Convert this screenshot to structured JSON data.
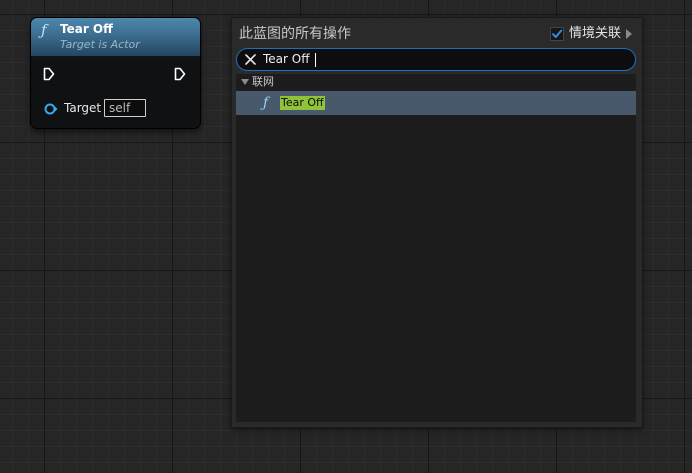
{
  "node": {
    "function_icon": "ƒ",
    "title": "Tear Off",
    "subtitle": "Target is Actor",
    "exec_in_icon": "exec-pin-in",
    "exec_out_icon": "exec-pin-out",
    "target_label": "Target",
    "target_value": "self",
    "header_color": "#3c6d8f"
  },
  "menu": {
    "title": "此蓝图的所有操作",
    "context_sensitive_label": "情境关联",
    "context_sensitive_checked": true,
    "search": {
      "value": "Tear Off",
      "placeholder": ""
    },
    "categories": [
      {
        "label": "联网",
        "expanded": true,
        "items": [
          {
            "icon": "ƒ",
            "label": "Tear Off",
            "selected": true
          }
        ]
      }
    ]
  },
  "colors": {
    "accent": "#1e6fc4",
    "selection": "#48596b",
    "highlight": "#8fc43a"
  }
}
